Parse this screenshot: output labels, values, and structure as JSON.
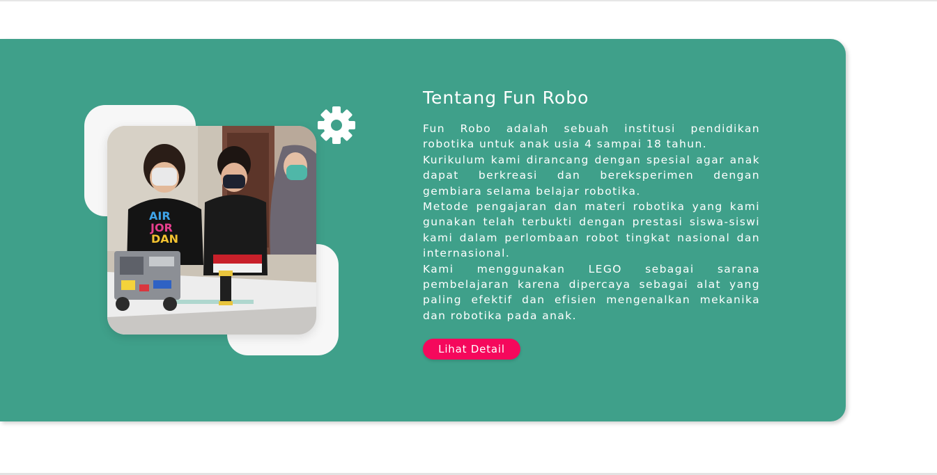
{
  "about": {
    "title": "Tentang Fun Robo",
    "paragraphs": [
      "Fun Robo adalah sebuah institusi pendidikan robotika untuk anak usia 4 sampai 18 tahun.",
      "Kurikulum kami dirancang dengan spesial agar anak dapat berkreasi dan bereksperimen dengan gembiara selama belajar robotika.",
      "Metode pengajaran dan materi robotika yang kami gunakan telah terbukti dengan prestasi siswa-siswi kami dalam perlombaan robot tingkat nasional dan internasional.",
      "Kami menggunakan LEGO sebagai sarana pembelajaran karena dipercaya sebagai alat yang paling efektif dan efisien mengenalkan mekanika dan robotika pada anak."
    ],
    "button_label": "Lihat Detail",
    "photo_icon": "children-with-robot-photo",
    "gear_icon": "gear-icon"
  },
  "colors": {
    "card_background": "#3fa08a",
    "accent_button": "#f5085c",
    "decor_square": "#f7f7f7",
    "text": "#ffffff"
  }
}
